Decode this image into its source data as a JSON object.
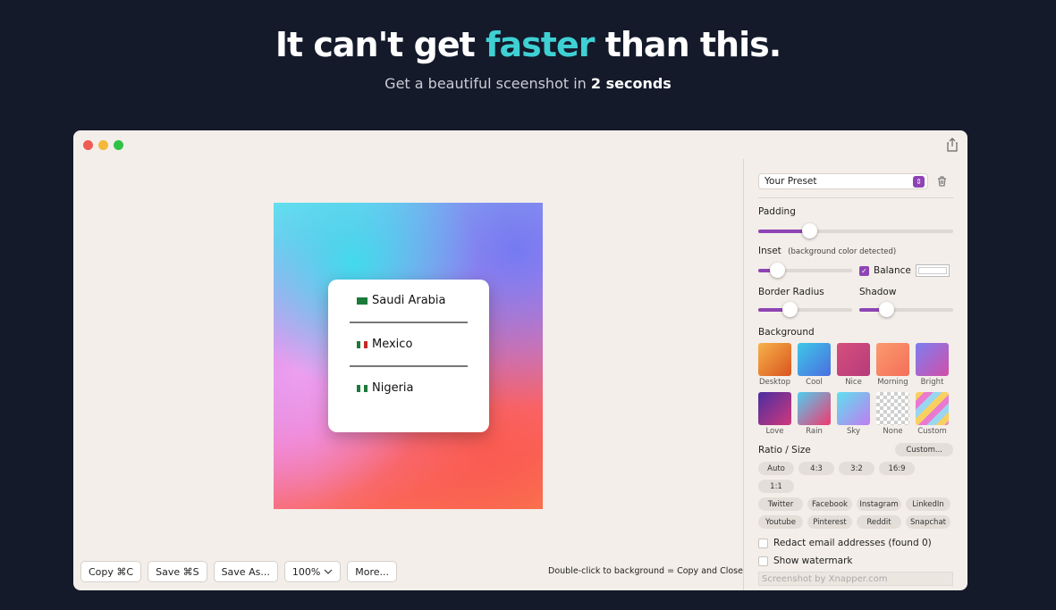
{
  "hero": {
    "title_pre": "It can't get ",
    "title_accent": "faster",
    "title_post": " than this.",
    "subtitle_pre": "Get a beautiful sceenshot in ",
    "subtitle_bold": "2 seconds"
  },
  "canvas": {
    "countries": [
      {
        "flag": "saudi-arabia-flag-icon",
        "name": "Saudi Arabia"
      },
      {
        "flag": "mexico-flag-icon",
        "name": "Mexico"
      },
      {
        "flag": "nigeria-flag-icon",
        "name": "Nigeria"
      }
    ]
  },
  "toolbar": {
    "copy": "Copy ⌘C",
    "save": "Save ⌘S",
    "save_as": "Save As...",
    "zoom": "100%",
    "more": "More...",
    "hint": "Double-click to background = Copy and Close"
  },
  "panel": {
    "preset": "Your Preset",
    "padding_label": "Padding",
    "padding_value": 0.26,
    "inset_label": "Inset",
    "inset_note": "(background color detected)",
    "inset_value": 0.2,
    "balance_label": "Balance",
    "balance_checked": true,
    "border_radius_label": "Border Radius",
    "border_radius_value": 0.33,
    "shadow_label": "Shadow",
    "shadow_value": 0.29,
    "background_label": "Background",
    "backgrounds": [
      {
        "name": "Desktop",
        "colors": [
          "#f7b24a",
          "#d9541e"
        ]
      },
      {
        "name": "Cool",
        "colors": [
          "#3ec7e8",
          "#4b6ee0"
        ]
      },
      {
        "name": "Nice",
        "colors": [
          "#d64f7e",
          "#b63b7a"
        ]
      },
      {
        "name": "Morning",
        "colors": [
          "#fb9a6e",
          "#f46f5a"
        ]
      },
      {
        "name": "Bright",
        "colors": [
          "#7c7ef0",
          "#d24fa8"
        ]
      },
      {
        "name": "Love",
        "colors": [
          "#4a2ea0",
          "#d0387c"
        ]
      },
      {
        "name": "Rain",
        "colors": [
          "#4fcff0",
          "#f3386f"
        ]
      },
      {
        "name": "Sky",
        "colors": [
          "#5ee0ee",
          "#c07cf0"
        ]
      },
      {
        "name": "None",
        "colors": [
          "#ffffff",
          "#cfcfcf"
        ]
      },
      {
        "name": "Custom",
        "colors": [
          "#f8d060",
          "#e97ad0"
        ]
      }
    ],
    "ratio_label": "Ratio / Size",
    "custom_button": "Custom...",
    "ratios": [
      "Auto",
      "4:3",
      "3:2",
      "16:9",
      "1:1"
    ],
    "platforms": [
      "Twitter",
      "Facebook",
      "Instagram",
      "LinkedIn",
      "Youtube",
      "Pinterest",
      "Reddit",
      "Snapchat"
    ],
    "redact_label": "Redact email addresses (found 0)",
    "watermark_label": "Show watermark",
    "watermark_placeholder": "Screenshot by Xnapper.com"
  },
  "colors": {
    "accent": "#8e44b5",
    "hero_accent": "#3fd0d4",
    "page_bg": "#141a2a"
  }
}
